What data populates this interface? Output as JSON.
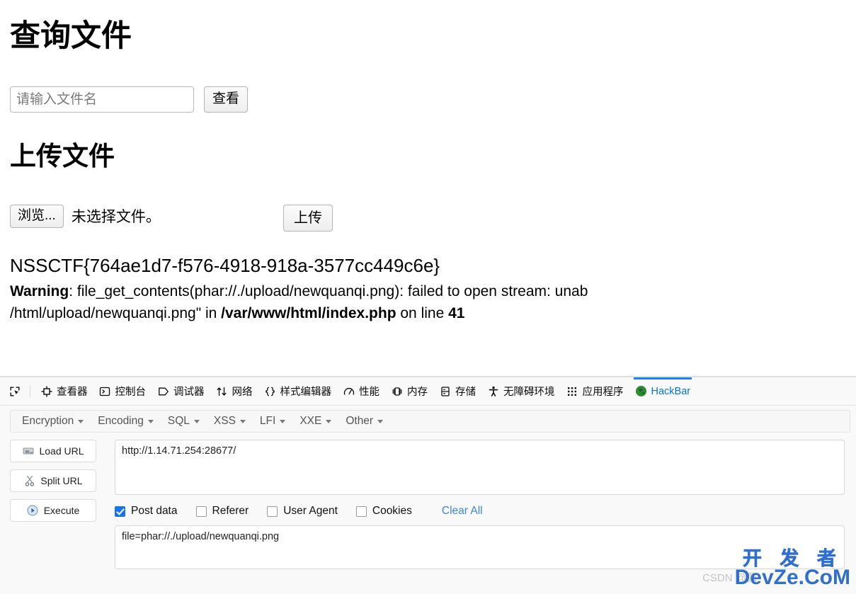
{
  "page": {
    "query_heading": "查询文件",
    "filename_placeholder": "请输入文件名",
    "filename_value": "",
    "view_button": "查看",
    "upload_heading": "上传文件",
    "browse_button": "浏览...",
    "no_file_text": "未选择文件。",
    "upload_button": "上传",
    "flag": "NSSCTF{764ae1d7-f576-4918-918a-3577cc449c6e}",
    "warning": {
      "label": "Warning",
      "text_1": ": file_get_contents(phar://./upload/newquanqi.png): failed to open stream: unab",
      "text_2": "/html/upload/newquanqi.png\" in ",
      "path": "/var/www/html/index.php",
      "text_3": " on line ",
      "line": "41"
    }
  },
  "devtools": {
    "picker_icon": "element-picker-icon",
    "tabs": [
      {
        "label": "查看器",
        "icon": "inspector-icon",
        "active": false
      },
      {
        "label": "控制台",
        "icon": "console-icon",
        "active": false
      },
      {
        "label": "调试器",
        "icon": "debugger-icon",
        "active": false
      },
      {
        "label": "网络",
        "icon": "network-icon",
        "active": false
      },
      {
        "label": "样式编辑器",
        "icon": "style-editor-icon",
        "active": false
      },
      {
        "label": "性能",
        "icon": "performance-icon",
        "active": false
      },
      {
        "label": "内存",
        "icon": "memory-icon",
        "active": false
      },
      {
        "label": "存储",
        "icon": "storage-icon",
        "active": false
      },
      {
        "label": "无障碍环境",
        "icon": "accessibility-icon",
        "active": false
      },
      {
        "label": "应用程序",
        "icon": "application-icon",
        "active": false
      },
      {
        "label": "HackBar",
        "icon": "hackbar-icon",
        "active": true
      }
    ],
    "active_tab_color": "#0a84ff"
  },
  "hackbar": {
    "menus": [
      {
        "label": "Encryption"
      },
      {
        "label": "Encoding"
      },
      {
        "label": "SQL"
      },
      {
        "label": "XSS"
      },
      {
        "label": "LFI"
      },
      {
        "label": "XXE"
      },
      {
        "label": "Other"
      }
    ],
    "buttons": [
      {
        "label": "Load URL",
        "icon": "load-url-icon"
      },
      {
        "label": "Split URL",
        "icon": "split-url-icon"
      },
      {
        "label": "Execute",
        "icon": "execute-icon"
      }
    ],
    "url_value": "http://1.14.71.254:28677/",
    "options": [
      {
        "label": "Post data",
        "checked": true
      },
      {
        "label": "Referer",
        "checked": false
      },
      {
        "label": "User Agent",
        "checked": false
      },
      {
        "label": "Cookies",
        "checked": false
      }
    ],
    "clear_all": "Clear All",
    "post_data_value": "file=phar://./upload/newquanqi.png"
  },
  "watermark": {
    "csdn": "CSDN @偶",
    "dev_cn": "开 发 者",
    "dev_en": "DevZe.CoM",
    "color": "#2f6fd0"
  }
}
